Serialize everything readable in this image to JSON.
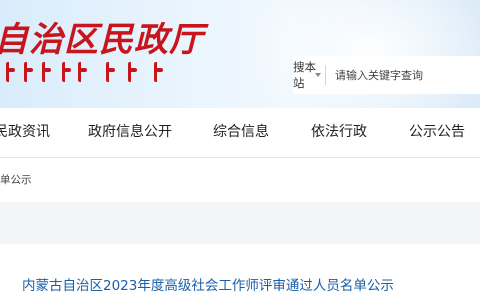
{
  "header": {
    "logo_text": "自治区民政厅",
    "brand_color": "#c8151c"
  },
  "search": {
    "scope_label": "搜本站",
    "placeholder": "请输入关键字查询",
    "icon": "chevron-down-icon"
  },
  "nav": {
    "items": [
      {
        "label": "民政资讯"
      },
      {
        "label": "政府信息公开"
      },
      {
        "label": "综合信息"
      },
      {
        "label": "依法行政"
      },
      {
        "label": "公示公告"
      }
    ]
  },
  "breadcrumb": {
    "text": "单公示"
  },
  "article": {
    "title": "内蒙古自治区2023年度高级社会工作师评审通过人员名单公示",
    "title_color": "#1a5fa8"
  }
}
